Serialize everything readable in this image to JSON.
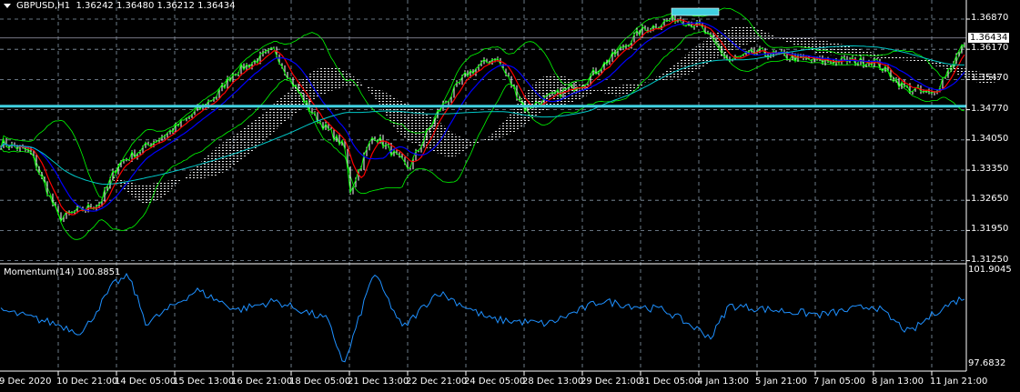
{
  "header": {
    "symbol": "GBPUSD,H1",
    "open": "1.36242",
    "high": "1.36480",
    "low": "1.36212",
    "close": "1.36434"
  },
  "momentum_label": "Momentum(14) 100.8851",
  "colors": {
    "background": "#000000",
    "candle": "#ffffff",
    "bands": "#00ff00",
    "ma_fast": "#ff0000",
    "ma_mid": "#0000ff",
    "ma_slow": "#00c8c8",
    "hline": "#40d0e0",
    "momentum": "#1e90ff",
    "grid": "#8899aa"
  },
  "chart_data": [
    {
      "type": "line",
      "title": "GBPUSD,H1",
      "ylim": [
        1.3125,
        1.3705
      ],
      "y_ticks": [
        "1.36870",
        "1.36170",
        "1.35470",
        "1.34770",
        "1.34050",
        "1.33350",
        "1.32650",
        "1.31950",
        "1.31250"
      ],
      "current_price": "1.36434",
      "horizontal_line": 1.3485,
      "x_ticks": [
        "9 Dec 2020",
        "10 Dec 21:00",
        "14 Dec 05:00",
        "15 Dec 13:00",
        "16 Dec 21:00",
        "18 Dec 05:00",
        "21 Dec 13:00",
        "22 Dec 21:00",
        "24 Dec 05:00",
        "28 Dec 13:00",
        "29 Dec 21:00",
        "31 Dec 05:00",
        "4 Jan 13:00",
        "5 Jan 21:00",
        "7 Jan 05:00",
        "8 Jan 13:00",
        "11 Jan 21:00"
      ],
      "series": [
        {
          "name": "close (approx, per tick index)",
          "x": [
            0,
            0.5,
            1,
            1.7,
            2,
            3,
            3.7,
            4,
            4.7,
            5,
            5.4,
            5.9,
            6,
            6.4,
            7,
            7.5,
            8,
            8.5,
            9,
            10,
            11,
            11.6,
            12,
            12.5,
            13,
            14,
            15,
            15.5,
            16,
            16.6
          ],
          "values": [
            1.34,
            1.338,
            1.3225,
            1.326,
            1.335,
            1.3435,
            1.351,
            1.3563,
            1.3615,
            1.354,
            1.346,
            1.339,
            1.329,
            1.342,
            1.334,
            1.347,
            1.356,
            1.36,
            1.348,
            1.354,
            1.366,
            1.369,
            1.367,
            1.359,
            1.361,
            1.359,
            1.359,
            1.353,
            1.351,
            1.3643
          ]
        }
      ]
    },
    {
      "type": "line",
      "title": "Momentum(14) 100.8851",
      "ylim": [
        97.6832,
        101.9045
      ],
      "y_ticks": [
        "101.9045",
        "97.6832"
      ],
      "series": [
        {
          "name": "Momentum(14)",
          "x": [
            0,
            0.94,
            1.4,
            1.95,
            2.2,
            2.5,
            3.36,
            4.06,
            4.7,
            5.6,
            5.9,
            6.4,
            6.9,
            7.5,
            8.4,
            9.4,
            10.3,
            11.4,
            12.2,
            12.5,
            14.1,
            15,
            15.6,
            16.1,
            16.7
          ],
          "values": [
            100.14,
            99.53,
            99.13,
            101.34,
            101.62,
            99.53,
            101.02,
            100.14,
            100.54,
            99.73,
            97.72,
            101.82,
            99.33,
            100.94,
            99.73,
            99.53,
            100.54,
            100.14,
            98.93,
            100.34,
            99.93,
            100.34,
            99.13,
            100.14,
            100.94
          ]
        }
      ]
    }
  ]
}
